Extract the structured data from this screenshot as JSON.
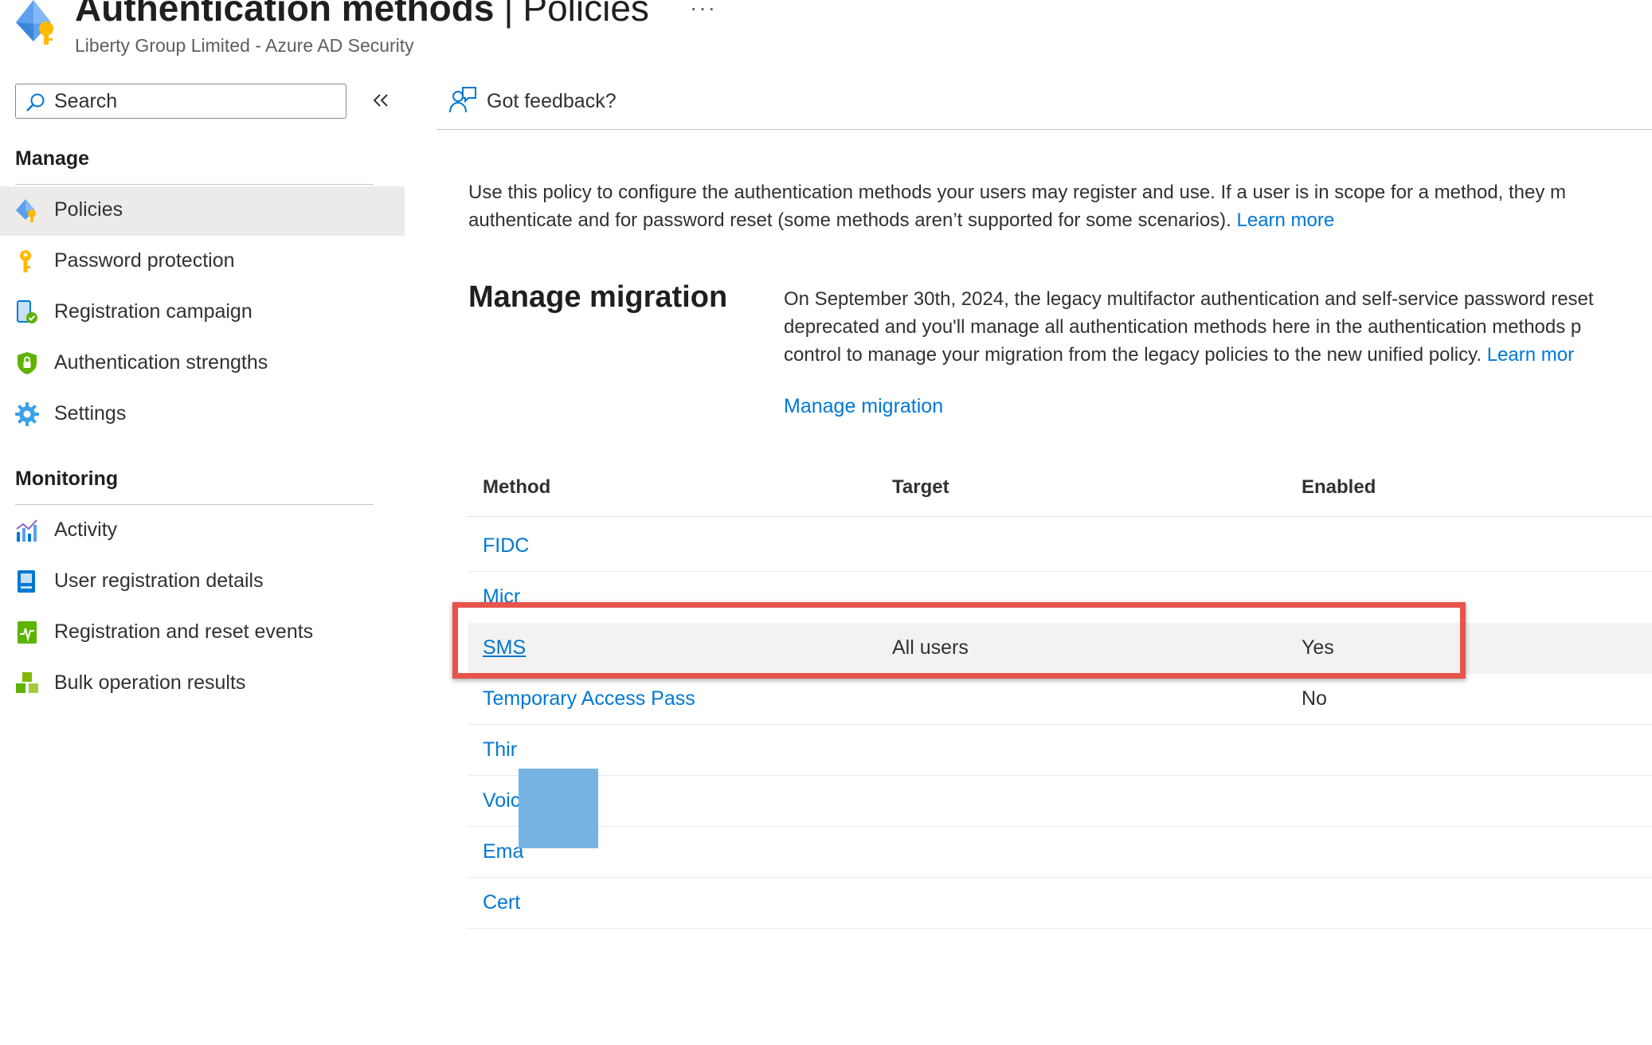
{
  "header": {
    "title_main": "Authentication methods",
    "title_separator": "|",
    "title_page": "Policies",
    "more_label": "···",
    "subtitle": "Liberty Group Limited - Azure AD Security"
  },
  "sidebar": {
    "search_placeholder": "Search",
    "sections": [
      {
        "title": "Manage",
        "items": [
          {
            "label": "Policies",
            "icon": "authentication-methods-icon",
            "active": true
          },
          {
            "label": "Password protection",
            "icon": "key-icon"
          },
          {
            "label": "Registration campaign",
            "icon": "device-check-icon"
          },
          {
            "label": "Authentication strengths",
            "icon": "shield-lock-icon"
          },
          {
            "label": "Settings",
            "icon": "gear-icon"
          }
        ]
      },
      {
        "title": "Monitoring",
        "items": [
          {
            "label": "Activity",
            "icon": "bar-chart-icon"
          },
          {
            "label": "User registration details",
            "icon": "user-details-icon"
          },
          {
            "label": "Registration and reset events",
            "icon": "activity-log-icon"
          },
          {
            "label": "Bulk operation results",
            "icon": "cubes-icon"
          }
        ]
      }
    ]
  },
  "toolbar": {
    "feedback_label": "Got feedback?"
  },
  "content": {
    "intro_line1": "Use this policy to configure the authentication methods your users may register and use. If a user is in scope for a method, they m",
    "intro_line2": "authenticate and for password reset (some methods aren’t supported for some scenarios).",
    "learn_more": "Learn more",
    "migration_heading": "Manage migration",
    "migration_line1": "On September 30th, 2024, the legacy multifactor authentication and self-service password reset",
    "migration_line2": "deprecated and you'll manage all authentication methods here in the authentication methods p",
    "migration_line3": "control to manage your migration from the legacy policies to the new unified policy.",
    "migration_learn_more": "Learn mor",
    "manage_migration_link": "Manage migration"
  },
  "table": {
    "columns": [
      "Method",
      "Target",
      "Enabled"
    ],
    "rows": [
      {
        "method": "FIDC",
        "target": "",
        "enabled": ""
      },
      {
        "method": "Micr",
        "target": "",
        "enabled": ""
      },
      {
        "method": "SMS",
        "target": "All users",
        "enabled": "Yes"
      },
      {
        "method": "Temporary Access Pass",
        "target": "",
        "enabled": "No"
      },
      {
        "method": "Thir",
        "target": "",
        "enabled": ""
      },
      {
        "method": "Voic",
        "target": "",
        "enabled": ""
      },
      {
        "method": "Ema",
        "target": "",
        "enabled": ""
      },
      {
        "method": "Cert",
        "target": "",
        "enabled": ""
      }
    ]
  },
  "colors": {
    "accent": "#0078d4",
    "highlight_border": "#e8534c",
    "redaction_block": "#78b4e3",
    "active_nav": "#edebe9"
  }
}
